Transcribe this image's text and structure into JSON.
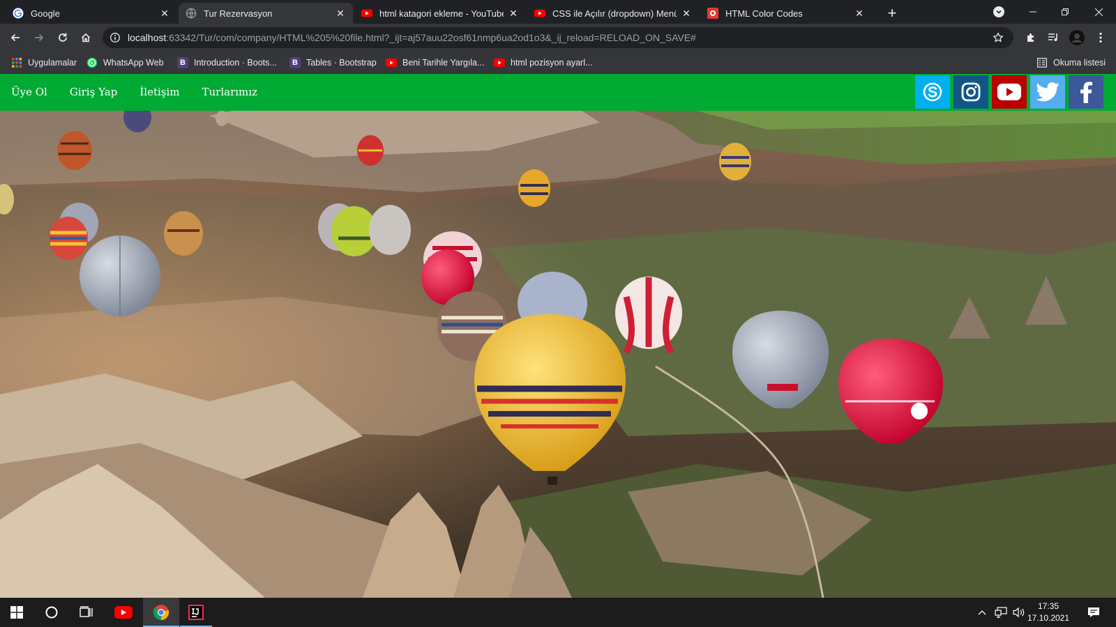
{
  "browser": {
    "tabs": [
      {
        "title": "Google",
        "icon": "google-icon",
        "active": false
      },
      {
        "title": "Tur Rezervasyon",
        "icon": "globe-icon",
        "active": true
      },
      {
        "title": "html katagori ekleme - YouTube",
        "icon": "youtube-icon",
        "active": false
      },
      {
        "title": "CSS ile Açılır (dropdown) Menü Y",
        "icon": "youtube-icon",
        "active": false
      },
      {
        "title": "HTML Color Codes",
        "icon": "color-codes-icon",
        "active": false
      }
    ],
    "url_host": "localhost",
    "url_rest": ":63342/Tur/com/company/HTML%205%20file.html?_ijt=aj57auu22osf61nmp6ua2od1o3&_ij_reload=RELOAD_ON_SAVE#",
    "bookmarks": [
      {
        "label": "Uygulamalar",
        "icon": "apps-grid-icon"
      },
      {
        "label": "WhatsApp Web",
        "icon": "whatsapp-icon"
      },
      {
        "label": "Introduction · Boots...",
        "icon": "bootstrap-icon"
      },
      {
        "label": "Tables · Bootstrap",
        "icon": "bootstrap-icon"
      },
      {
        "label": "Beni Tarihle Yargıla...",
        "icon": "youtube-icon"
      },
      {
        "label": "html pozisyon ayarl...",
        "icon": "youtube-icon"
      }
    ],
    "reading_list": "Okuma listesi"
  },
  "site": {
    "nav": [
      "Üye Ol",
      "Giriş Yap",
      "İletişim",
      "Turlarımız"
    ],
    "nav_color": "#00aa33",
    "social": [
      {
        "name": "skype-icon",
        "color": "#00aff0"
      },
      {
        "name": "instagram-icon",
        "color": "#125688"
      },
      {
        "name": "youtube-icon",
        "color": "#bb0000"
      },
      {
        "name": "twitter-icon",
        "color": "#55acee"
      },
      {
        "name": "facebook-icon",
        "color": "#3b5998"
      }
    ]
  },
  "taskbar": {
    "time": "17:35",
    "date": "17.10.2021"
  }
}
